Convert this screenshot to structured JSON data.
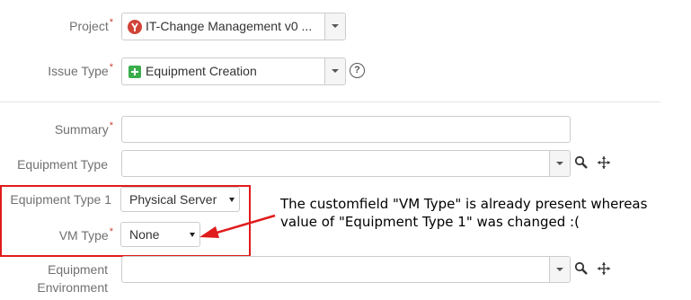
{
  "fields": {
    "project": {
      "label": "Project",
      "required": "*",
      "value": "IT-Change Management v0 ..."
    },
    "issue_type": {
      "label": "Issue Type",
      "required": "*",
      "value": "Equipment Creation",
      "help": "?"
    },
    "summary": {
      "label": "Summary",
      "required": "*",
      "value": ""
    },
    "equipment_type": {
      "label": "Equipment Type",
      "value": ""
    },
    "equipment_type_1": {
      "label": "Equipment Type 1",
      "value": "Physical Server"
    },
    "vm_type": {
      "label": "VM Type",
      "required": "*",
      "value": "None"
    },
    "equipment_environment": {
      "label_line1": "Equipment",
      "label_line2": "Environment",
      "value": ""
    }
  },
  "annotation": {
    "line1": "The customfield \"VM Type\" is already present whereas",
    "line2": "value of \"Equipment Type 1\" was changed :("
  },
  "colors": {
    "highlight_red": "#e01b1b",
    "required_red": "#d04437",
    "project_icon_red": "#d04437",
    "issue_type_icon_green": "#3bad4c"
  },
  "icons": [
    "project-avatar-icon",
    "equipment-creation-icon",
    "help-icon",
    "search-icon",
    "move-arrows-icon"
  ]
}
